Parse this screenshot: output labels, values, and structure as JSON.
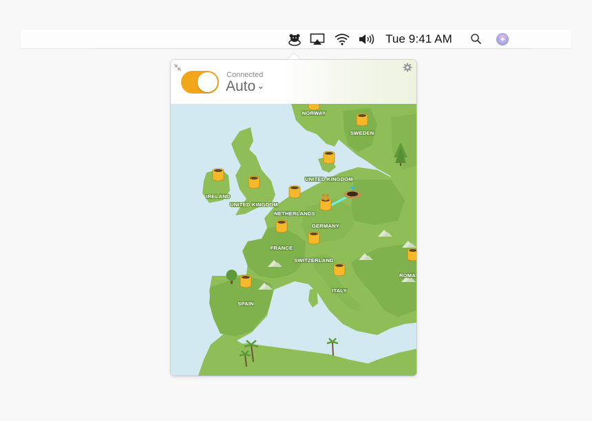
{
  "menubar": {
    "clock": "Tue 9:41 AM",
    "icons": [
      "tunnelbear-icon",
      "airplay-icon",
      "wifi-icon",
      "volume-icon",
      "spotlight-search-icon",
      "siri-icon"
    ]
  },
  "app": {
    "status": "Connected",
    "location": "Auto",
    "chevron": "⌄",
    "toggle_on": true,
    "accent": "#f2a71b"
  },
  "map": {
    "countries": [
      {
        "id": "norway",
        "label": "NORWAY"
      },
      {
        "id": "sweden",
        "label": "SWEDEN"
      },
      {
        "id": "ireland",
        "label": "IRELAND"
      },
      {
        "id": "uk-west",
        "label": "UNITED KINGDOM"
      },
      {
        "id": "uk-north",
        "label": "UNITED KINGDOM"
      },
      {
        "id": "netherlands",
        "label": "NETHERLANDS"
      },
      {
        "id": "germany",
        "label": "GERMANY"
      },
      {
        "id": "france",
        "label": "FRANCE"
      },
      {
        "id": "switzerland",
        "label": "SWITZERLAND"
      },
      {
        "id": "italy",
        "label": "ITALY"
      },
      {
        "id": "spain",
        "label": "SPAIN"
      },
      {
        "id": "romania",
        "label": "ROMA"
      }
    ]
  }
}
